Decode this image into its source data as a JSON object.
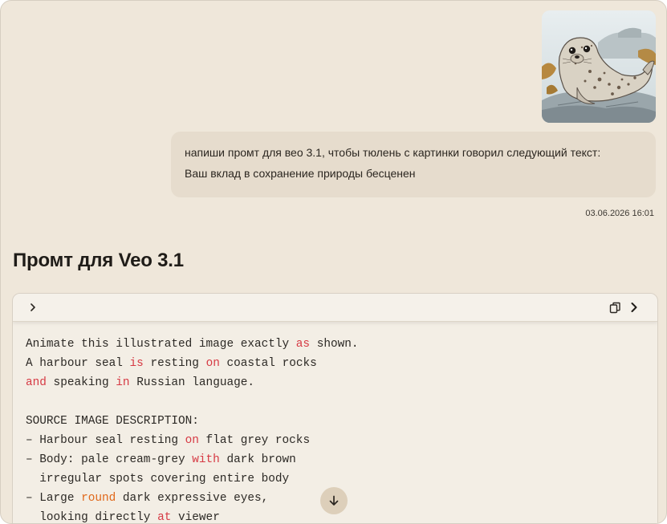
{
  "user_message": {
    "lines": [
      "напиши промт для вео 3.1, чтобы тюлень с картинки говорил следующий текст:",
      "Ваш вклад в сохранение природы бесценен"
    ],
    "timestamp": "03.06.2026 16:01"
  },
  "response": {
    "heading": "Промт для Veo 3.1"
  },
  "code_block": {
    "icons": {
      "expand": "chevron-right-icon",
      "copy": "copy-icon",
      "open": "chevron-right-icon"
    },
    "lines": [
      [
        {
          "t": "Animate this illustrated image exactly "
        },
        {
          "t": "as",
          "c": "red"
        },
        {
          "t": " shown."
        }
      ],
      [
        {
          "t": "A harbour seal "
        },
        {
          "t": "is",
          "c": "red"
        },
        {
          "t": " resting "
        },
        {
          "t": "on",
          "c": "red"
        },
        {
          "t": " coastal rocks"
        }
      ],
      [
        {
          "t": "and",
          "c": "red"
        },
        {
          "t": " speaking "
        },
        {
          "t": "in",
          "c": "red"
        },
        {
          "t": " Russian language."
        }
      ],
      [
        {
          "t": ""
        }
      ],
      [
        {
          "t": "SOURCE IMAGE DESCRIPTION:"
        }
      ],
      [
        {
          "t": "– Harbour seal resting "
        },
        {
          "t": "on",
          "c": "red"
        },
        {
          "t": " flat grey rocks"
        }
      ],
      [
        {
          "t": "– Body: pale cream-grey "
        },
        {
          "t": "with",
          "c": "red"
        },
        {
          "t": " dark brown"
        }
      ],
      [
        {
          "t": "  irregular spots covering entire body"
        }
      ],
      [
        {
          "t": "– Large "
        },
        {
          "t": "round",
          "c": "orange"
        },
        {
          "t": " dark expressive eyes,"
        }
      ],
      [
        {
          "t": "  looking directly "
        },
        {
          "t": "at",
          "c": "red"
        },
        {
          "t": " viewer"
        }
      ]
    ]
  },
  "colors": {
    "background": "#efe7da",
    "bubble": "#e6dccd",
    "keyword_red": "#d63a44",
    "keyword_orange": "#e0681a"
  }
}
